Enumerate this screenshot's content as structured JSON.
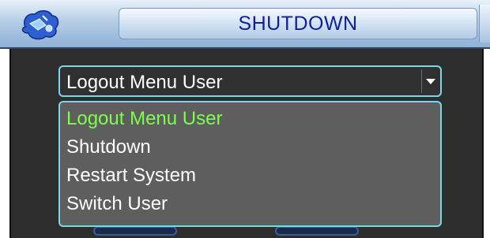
{
  "window": {
    "title": "SHUTDOWN",
    "logo_icon": "cursor-hand-logo-icon"
  },
  "select": {
    "value": "Logout Menu User",
    "arrow_icon": "chevron-down-icon"
  },
  "options": [
    {
      "label": "Logout Menu User",
      "selected": true
    },
    {
      "label": "Shutdown",
      "selected": false
    },
    {
      "label": "Restart System",
      "selected": false
    },
    {
      "label": "Switch User",
      "selected": false
    }
  ],
  "colors": {
    "title_text": "#0d1f9c",
    "accent_border": "#79d8e6",
    "selected_option": "#7cff49",
    "dropdown_bg": "#5e5e5e",
    "panel_bg": "#2d2d2d"
  }
}
